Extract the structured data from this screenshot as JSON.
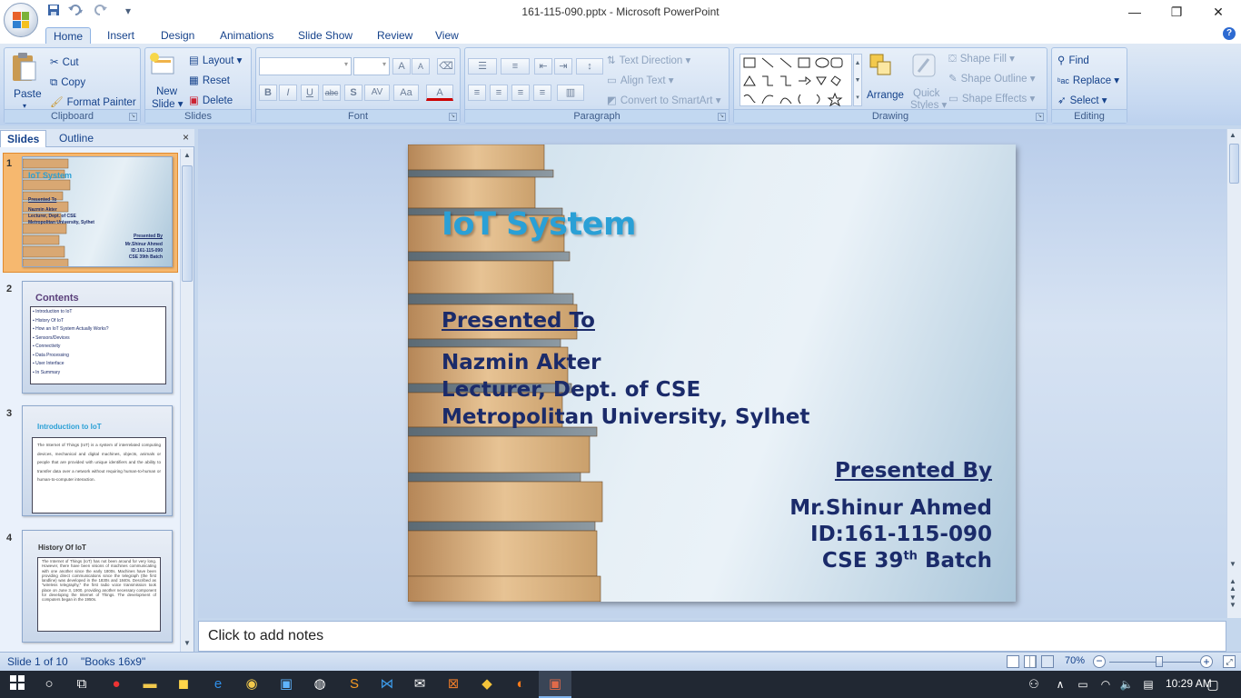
{
  "window": {
    "title": "161-115-090.pptx - Microsoft PowerPoint",
    "minimize": "—",
    "restore": "❐",
    "close": "✕"
  },
  "qat": {
    "save_icon": "save-icon",
    "undo_icon": "undo-icon",
    "redo_icon": "redo-icon",
    "customize": "▾"
  },
  "tabs": [
    "Home",
    "Insert",
    "Design",
    "Animations",
    "Slide Show",
    "Review",
    "View"
  ],
  "help_label": "?",
  "ribbon": {
    "clipboard": {
      "label": "Clipboard",
      "paste": "Paste",
      "cut": "Cut",
      "copy": "Copy",
      "format_painter": "Format Painter"
    },
    "slides": {
      "label": "Slides",
      "new_slide": "New",
      "new_slide2": "Slide",
      "layout": "Layout",
      "reset": "Reset",
      "delete": "Delete"
    },
    "font": {
      "label": "Font",
      "bold": "B",
      "italic": "I",
      "underline": "U",
      "strike": "abc",
      "shadow": "S",
      "spacing": "AV",
      "case": "Aa",
      "color": "A",
      "grow": "A",
      "shrink": "A"
    },
    "paragraph": {
      "label": "Paragraph",
      "text_direction": "Text Direction",
      "align_text": "Align Text",
      "convert": "Convert to SmartArt"
    },
    "drawing": {
      "label": "Drawing",
      "arrange": "Arrange",
      "quick_styles": "Quick",
      "quick_styles2": "Styles",
      "shape_fill": "Shape Fill",
      "shape_outline": "Shape Outline",
      "shape_effects": "Shape Effects"
    },
    "editing": {
      "label": "Editing",
      "find": "Find",
      "replace": "Replace",
      "select": "Select"
    }
  },
  "panel": {
    "tab_slides": "Slides",
    "tab_outline": "Outline",
    "close": "×"
  },
  "thumbnails": [
    {
      "num": "1",
      "title": "IoT System",
      "sub1": "Presented To",
      "sub2": "Nazmin Akter",
      "sub3": "Lecturer, Dept. of CSE",
      "sub4": "Metropolitan University, Sylhet",
      "pb": "Presented By",
      "pb1": "Mr.Shinur Ahmed",
      "pb2": "ID:161-115-090",
      "pb3": "CSE 39th Batch"
    },
    {
      "num": "2",
      "title": "Contents",
      "items": [
        "Introduction to IoT",
        "History Of IoT",
        "How an IoT System Actually Works?",
        "Sensors/Devices",
        "Connectivity",
        "Data Processing",
        "User Interface",
        "In Summary"
      ]
    },
    {
      "num": "3",
      "title": "Introduction to IoT",
      "body": "The Internet of Things (IoT) is a system of interrelated computing devices, mechanical and digital machines, objects, animals or people that are provided with unique identifiers and the ability to transfer data over a network without requiring human-to-human or human-to-computer interaction."
    },
    {
      "num": "4",
      "title": "History Of IoT",
      "body": "The Internet of Things (IoT) has not been around for very long. However, there have been visions of machines communicating with one another since the early 1800s. Machines have been providing direct communications since the telegraph (the first landline) was developed in the 1830s and 1840s. Described as \"wireless telegraphy,\" the first radio voice transmission took place on June 3, 1900, providing another necessary component for developing the Internet of Things. The development of computers began in the 1950s."
    }
  ],
  "slide": {
    "title": "IoT System",
    "presented_to": "Presented To",
    "name": "Nazmin Akter",
    "role": "Lecturer, Dept. of CSE",
    "university": "Metropolitan University, Sylhet",
    "presented_by": "Presented By",
    "author": "Mr.Shinur Ahmed",
    "id": "ID:161-115-090",
    "batch_prefix": "CSE 39",
    "batch_sup": "th",
    "batch_suffix": " Batch"
  },
  "notes_placeholder": "Click to add notes",
  "status": {
    "slide_info": "Slide 1 of 10",
    "theme": "\"Books 16x9\"",
    "zoom": "70%",
    "zoom_level": 0.55
  },
  "taskbar": {
    "time": "10:29 AM"
  }
}
